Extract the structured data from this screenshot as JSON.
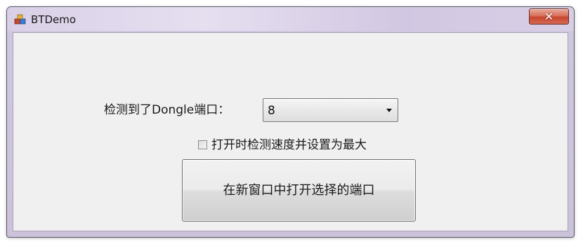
{
  "window": {
    "title": "BTDemo",
    "close_symbol": "✕",
    "app_icon": "app-icon"
  },
  "form": {
    "dongle_label": "检测到了Dongle端口：",
    "port_select": {
      "selected": "8"
    },
    "max_speed_checkbox": {
      "label": "打开时检测速度并设置为最大",
      "checked": false
    },
    "open_button_label": "在新窗口中打开选择的端口"
  }
}
